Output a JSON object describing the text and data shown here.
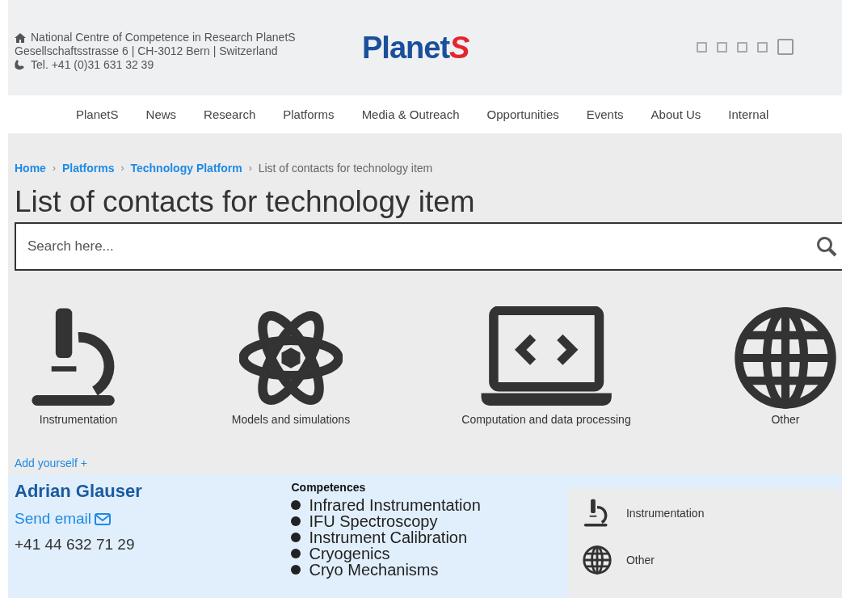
{
  "header": {
    "org": "National Centre of Competence in Research PlanetS",
    "address": "Gesellschaftsstrasse 6 | CH-3012 Bern | Switzerland",
    "phone": "Tel. +41 (0)31 631 32 39",
    "logo_main": "Planet",
    "logo_accent": "S"
  },
  "nav": [
    "PlanetS",
    "News",
    "Research",
    "Platforms",
    "Media & Outreach",
    "Opportunities",
    "Events",
    "About Us",
    "Internal"
  ],
  "breadcrumb": [
    {
      "label": "Home",
      "link": true
    },
    {
      "separator": "›",
      "label": "Platforms",
      "link": true
    },
    {
      "separator": "›",
      "label": "Technology Platform",
      "link": true
    },
    {
      "separator": "›",
      "label": "List of contacts for technology item",
      "link": false
    }
  ],
  "page_title": "List of contacts for technology item",
  "search": {
    "placeholder": "Search here..."
  },
  "categories": [
    {
      "kind": "microscope",
      "label": "Instrumentation"
    },
    {
      "kind": "atom",
      "label": "Models and simulations"
    },
    {
      "kind": "laptop",
      "label": "Computation and data processing"
    },
    {
      "kind": "globe",
      "label": "Other"
    }
  ],
  "add_link": "Add yourself +",
  "contact": {
    "name": "Adrian Glauser",
    "email_link": "Send email",
    "phone": "+41 44 632 71 29",
    "competences_title": "Competences",
    "competences": [
      "Infrared Instrumentation",
      "IFU Spectroscopy",
      "Instrument Calibration",
      "Cryogenics",
      "Cryo Mechanisms"
    ],
    "tags": [
      {
        "kind": "microscope",
        "label": "Instrumentation"
      },
      {
        "kind": "globe",
        "label": "Other"
      }
    ]
  }
}
